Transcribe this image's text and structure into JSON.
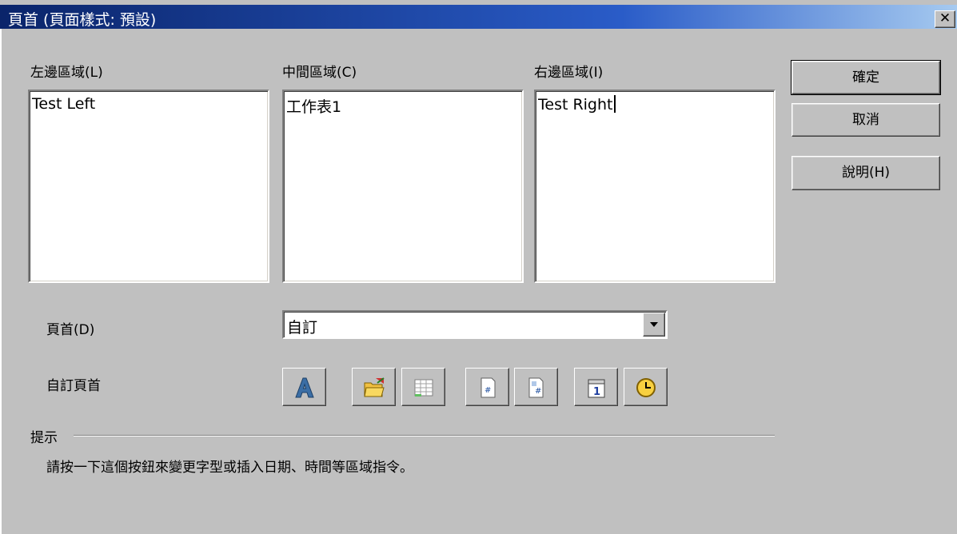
{
  "dialog": {
    "title": "頁首 (頁面樣式: 預設)",
    "close_glyph": "✕"
  },
  "areas": {
    "left": {
      "label": "左邊區域(L)",
      "text": "Test Left"
    },
    "center": {
      "label": "中間區域(C)",
      "text": "工作表1"
    },
    "right": {
      "label": "右邊區域(I)",
      "text": "Test Right"
    }
  },
  "buttons": {
    "ok": "確定",
    "cancel": "取消",
    "help": "說明(H)"
  },
  "header": {
    "label": "頁首(D)",
    "selected": "自訂"
  },
  "custom_header": {
    "label": "自訂頁首",
    "tools": [
      {
        "icon": "text-attributes-icon"
      },
      {
        "icon": "file-name-icon"
      },
      {
        "icon": "sheet-name-icon"
      },
      {
        "icon": "page-number-icon"
      },
      {
        "icon": "page-count-icon"
      },
      {
        "icon": "date-icon"
      },
      {
        "icon": "time-icon"
      }
    ]
  },
  "hint": {
    "label": "提示",
    "text": "請按一下這個按鈕來變更字型或插入日期、時間等區域指令。"
  }
}
